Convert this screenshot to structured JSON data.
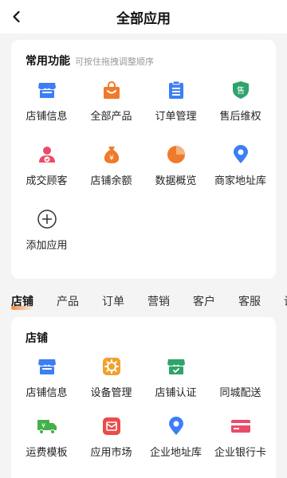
{
  "header": {
    "title": "全部应用"
  },
  "common": {
    "title": "常用功能",
    "hint": "可按住拖拽调整顺序",
    "items": [
      {
        "label": "店铺信息",
        "icon": "shop-icon",
        "color": "#3c7ef5"
      },
      {
        "label": "全部产品",
        "icon": "bag-icon",
        "color": "#f07a2b"
      },
      {
        "label": "订单管理",
        "icon": "clipboard-icon",
        "color": "#3c7ef5"
      },
      {
        "label": "售后维权",
        "icon": "shield-icon",
        "color": "#2ea46a"
      },
      {
        "label": "成交顾客",
        "icon": "customer-icon",
        "color": "#ea4b6a"
      },
      {
        "label": "店铺余额",
        "icon": "money-bag-icon",
        "color": "#f07a2b"
      },
      {
        "label": "数据概览",
        "icon": "pie-chart-icon",
        "color": "#f07a2b"
      },
      {
        "label": "商家地址库",
        "icon": "location-pin-icon",
        "color": "#3c7ef5"
      },
      {
        "label": "添加应用",
        "icon": "plus-circle-icon",
        "color": "#333333"
      }
    ]
  },
  "tabs": [
    {
      "label": "店铺",
      "active": true
    },
    {
      "label": "产品"
    },
    {
      "label": "订单"
    },
    {
      "label": "营销"
    },
    {
      "label": "客户"
    },
    {
      "label": "客服"
    },
    {
      "label": "设"
    }
  ],
  "shop": {
    "title": "店铺",
    "items": [
      {
        "label": "店铺信息",
        "icon": "shop-icon",
        "color": "#3c7ef5"
      },
      {
        "label": "设备管理",
        "icon": "gear-icon",
        "color": "#f0a12b"
      },
      {
        "label": "店铺认证",
        "icon": "verified-shop-icon",
        "color": "#2ea46a"
      },
      {
        "label": "同城配送",
        "icon": "delivery-icon",
        "color": "#3c7ef5"
      },
      {
        "label": "运费模板",
        "icon": "truck-icon",
        "color": "#45b04a"
      },
      {
        "label": "应用市场",
        "icon": "market-icon",
        "color": "#ea4b4b"
      },
      {
        "label": "企业地址库",
        "icon": "location-pin-icon",
        "color": "#3c7ef5"
      },
      {
        "label": "企业银行卡",
        "icon": "bank-card-icon",
        "color": "#ea4b6a"
      }
    ]
  }
}
